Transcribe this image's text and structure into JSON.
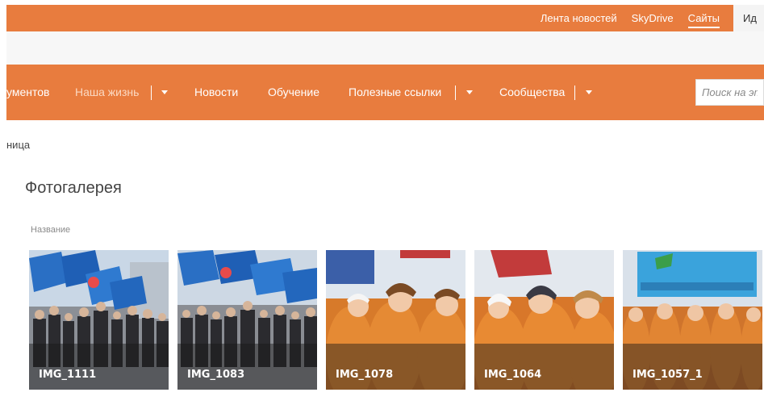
{
  "suite_bar": {
    "links": [
      {
        "label": "Лента новостей",
        "active": false
      },
      {
        "label": "SkyDrive",
        "active": false
      },
      {
        "label": "Сайты",
        "active": true
      }
    ],
    "user_label": "Ид"
  },
  "top_nav": {
    "items": [
      {
        "label": "ументов"
      },
      {
        "label": "Наша жизнь"
      },
      {
        "label": "Новости"
      },
      {
        "label": "Обучение"
      },
      {
        "label": "Полезные ссылки"
      },
      {
        "label": "Сообщества"
      }
    ],
    "search_placeholder": "Поиск на эт"
  },
  "breadcrumb": "ница",
  "page": {
    "title": "Фотогалерея",
    "column_header": "Название"
  },
  "gallery": {
    "items": [
      {
        "label": "IMG_1111",
        "scene": "flags-crowd"
      },
      {
        "label": "IMG_1083",
        "scene": "flags-crowd"
      },
      {
        "label": "IMG_1078",
        "scene": "orange-group"
      },
      {
        "label": "IMG_1064",
        "scene": "orange-group"
      },
      {
        "label": "IMG_1057_1",
        "scene": "banner-group"
      }
    ]
  },
  "colors": {
    "brand": "#e87c3e",
    "nav_dim_text": "#fbd9c2",
    "caption_overlay": "rgba(25,25,25,0.45)"
  }
}
